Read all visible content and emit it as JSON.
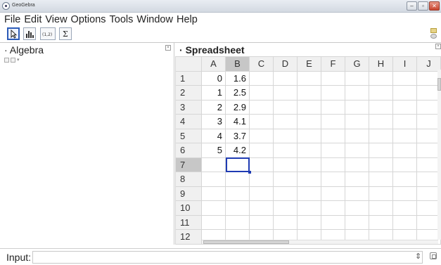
{
  "window": {
    "title": "GeoGebra"
  },
  "menu": [
    "File",
    "Edit",
    "View",
    "Options",
    "Tools",
    "Window",
    "Help"
  ],
  "toolbar": {
    "tools": [
      {
        "name": "move-tool",
        "icon": "arrow-pointer-icon"
      },
      {
        "name": "bar-chart-tool",
        "icon": "bar-chart-icon"
      },
      {
        "name": "point-list-tool",
        "icon": "point-coordinates-icon",
        "label": "(1,2)"
      },
      {
        "name": "sum-tool",
        "icon": "sigma-icon",
        "label": "Σ"
      }
    ]
  },
  "algebra": {
    "title": "Algebra"
  },
  "spreadsheet": {
    "title": "Spreadsheet",
    "columns": [
      "A",
      "B",
      "C",
      "D",
      "E",
      "F",
      "G",
      "H",
      "I",
      "J"
    ],
    "selected_column": "B",
    "selected_row": "7",
    "rows": [
      {
        "num": "1",
        "cells": [
          "0",
          "1.6",
          "",
          "",
          "",
          "",
          "",
          "",
          "",
          ""
        ]
      },
      {
        "num": "2",
        "cells": [
          "1",
          "2.5",
          "",
          "",
          "",
          "",
          "",
          "",
          "",
          ""
        ]
      },
      {
        "num": "3",
        "cells": [
          "2",
          "2.9",
          "",
          "",
          "",
          "",
          "",
          "",
          "",
          ""
        ]
      },
      {
        "num": "4",
        "cells": [
          "3",
          "4.1",
          "",
          "",
          "",
          "",
          "",
          "",
          "",
          ""
        ]
      },
      {
        "num": "5",
        "cells": [
          "4",
          "3.7",
          "",
          "",
          "",
          "",
          "",
          "",
          "",
          ""
        ]
      },
      {
        "num": "6",
        "cells": [
          "5",
          "4.2",
          "",
          "",
          "",
          "",
          "",
          "",
          "",
          ""
        ]
      },
      {
        "num": "7",
        "cells": [
          "",
          "",
          "",
          "",
          "",
          "",
          "",
          "",
          "",
          ""
        ]
      },
      {
        "num": "8",
        "cells": [
          "",
          "",
          "",
          "",
          "",
          "",
          "",
          "",
          "",
          ""
        ]
      },
      {
        "num": "9",
        "cells": [
          "",
          "",
          "",
          "",
          "",
          "",
          "",
          "",
          "",
          ""
        ]
      },
      {
        "num": "10",
        "cells": [
          "",
          "",
          "",
          "",
          "",
          "",
          "",
          "",
          "",
          ""
        ]
      },
      {
        "num": "11",
        "cells": [
          "",
          "",
          "",
          "",
          "",
          "",
          "",
          "",
          "",
          ""
        ]
      },
      {
        "num": "12",
        "cells": [
          "",
          "",
          "",
          "",
          "",
          "",
          "",
          "",
          "",
          ""
        ]
      }
    ]
  },
  "inputbar": {
    "label": "Input:",
    "value": "",
    "symbol": "⇕"
  }
}
